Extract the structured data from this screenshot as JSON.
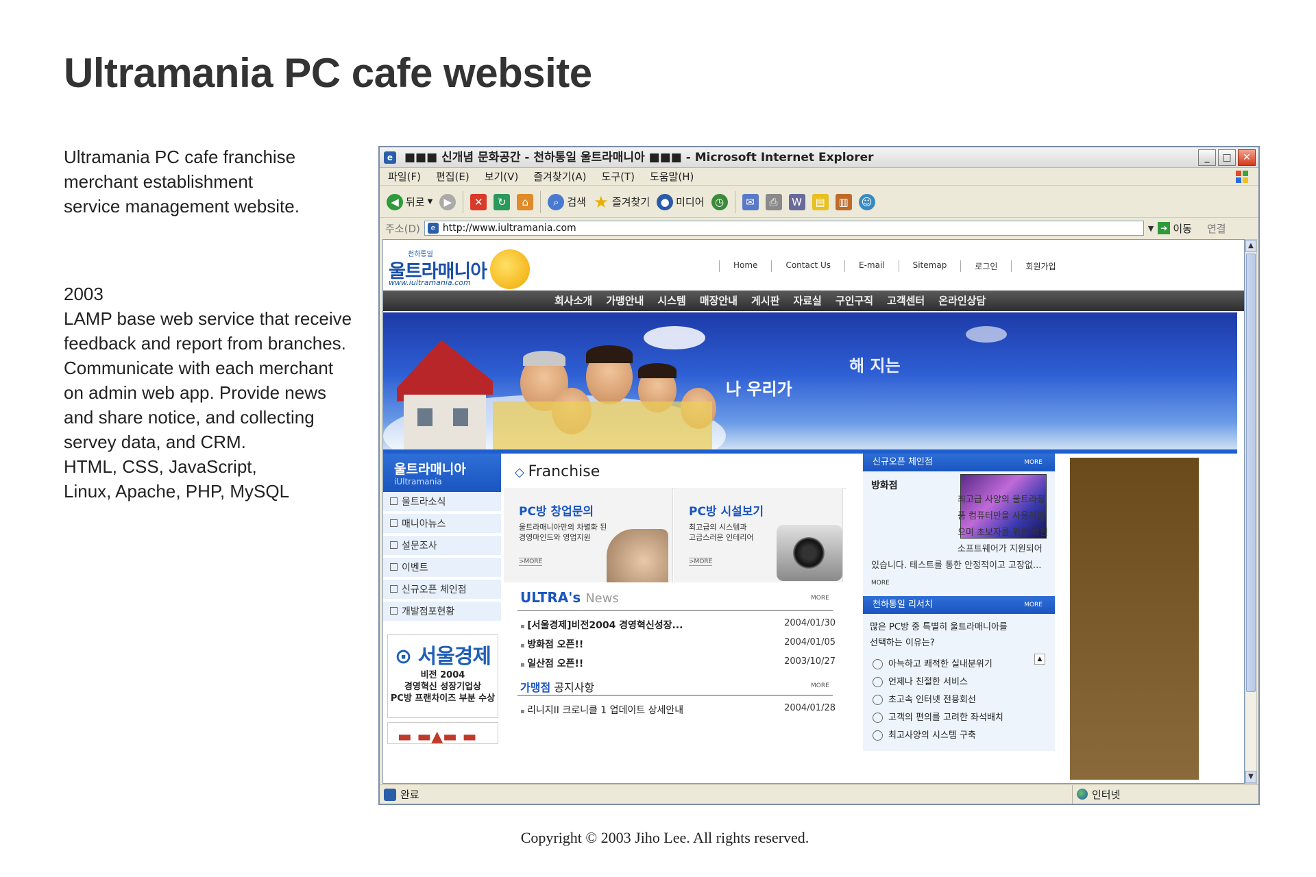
{
  "page": {
    "title": "Ultramania PC cafe website",
    "description_lines": [
      "Ultramania PC cafe franchise",
      "merchant establishment",
      "service management website."
    ],
    "details_lines": [
      "2003",
      "LAMP base web service that receive",
      "feedback and report from branches.",
      "Communicate with each merchant",
      "on admin web app. Provide news",
      "and share notice, and collecting",
      "servey data, and CRM.",
      "HTML, CSS, JavaScript,",
      "Linux, Apache, PHP, MySQL"
    ],
    "copyright": "Copyright © 2003 Jiho Lee. All rights reserved."
  },
  "browser": {
    "window_title": "■■■ 신개념 문화공간 - 천하통일 울트라매니아 ■■■ - Microsoft Internet Explorer",
    "menu": [
      "파일(F)",
      "편집(E)",
      "보기(V)",
      "즐겨찾기(A)",
      "도구(T)",
      "도움말(H)"
    ],
    "toolbar": {
      "back": "뒤로",
      "search": "검색",
      "favorites": "즐겨찾기",
      "media": "미디어"
    },
    "address_label": "주소(D)",
    "url": "http://www.iultramania.com",
    "go_label": "이동",
    "links_label": "연결",
    "status": "완료",
    "zone": "인터넷"
  },
  "site": {
    "logo_small": "천하통일",
    "logo_text": "울트라매니아",
    "logo_url": "www.iultramania.com",
    "top_links": [
      "Home",
      "Contact Us",
      "E-mail",
      "Sitemap",
      "로그인",
      "회원가입"
    ],
    "gnb": [
      "회사소개",
      "가맹안내",
      "시스템",
      "매장안내",
      "게시판",
      "자료실",
      "구인구직",
      "고객센터",
      "온라인상담"
    ],
    "hero_text1": "나 우리가",
    "hero_text2": "해 지는",
    "sidebar": {
      "title": "울트라매니아",
      "subtitle": "iUltramania",
      "items": [
        "울트라소식",
        "매니아뉴스",
        "설문조사",
        "이벤트",
        "신규오픈 체인점",
        "개발점포현황"
      ]
    },
    "banner": {
      "logo": "서울경제",
      "line1": "비전 2004",
      "line2": "경영혁신 성장기업상",
      "line3": "PC방 프랜차이즈 부분 수상"
    },
    "franchise": {
      "title": "Franchise",
      "box1": {
        "title": "PC방 창업문의",
        "desc1": "울트라매니아만의 차별화 된",
        "desc2": "경영마인드와 영업지원",
        "more": ">MORE"
      },
      "box2": {
        "title": "PC방 시설보기",
        "desc1": "최고급의 시스템과",
        "desc2": "고급스러운 인테리어",
        "more": ">MORE"
      }
    },
    "news": {
      "title": "ULTRA's",
      "title2": "News",
      "more": "MORE",
      "items": [
        {
          "title": "[서울경제]비전2004 경영혁신성장...",
          "date": "2004/01/30"
        },
        {
          "title": "방화점 오픈!!",
          "date": "2004/01/05"
        },
        {
          "title": "일산점 오픈!!",
          "date": "2003/10/27"
        }
      ]
    },
    "notice": {
      "title_bold": "가맹점",
      "title_rest": "공지사항",
      "more": "MORE",
      "items": [
        {
          "title": "리니지II 크로니클 1 업데이트 상세안내",
          "date": "2004/01/28"
        }
      ]
    },
    "new_store": {
      "header": "신규오픈 체인점",
      "more": "MORE",
      "name": "방화점",
      "body": "최고급 사양의 울트라정품 컴퓨터만을 사용하였으며 초보자를 위한 복원 소프트웨어가 지원되어 있습니다. 테스트를 통한 안정적이고 고장없...",
      "more2": "MORE"
    },
    "survey": {
      "header": "천하통일 리서치",
      "more": "MORE",
      "question1": "많은 PC방 중 특별히 울트라매니아를",
      "question2": "선택하는 이유는?",
      "options": [
        "아늑하고 쾌적한 실내분위기",
        "언제나 친절한 서비스",
        "초고속 인터넷 전용회선",
        "고객의 편의를 고려한 좌석배치",
        "최고사양의 시스템 구축"
      ]
    }
  },
  "colors": {
    "accent": "#1a55c0",
    "title": "#333333"
  }
}
